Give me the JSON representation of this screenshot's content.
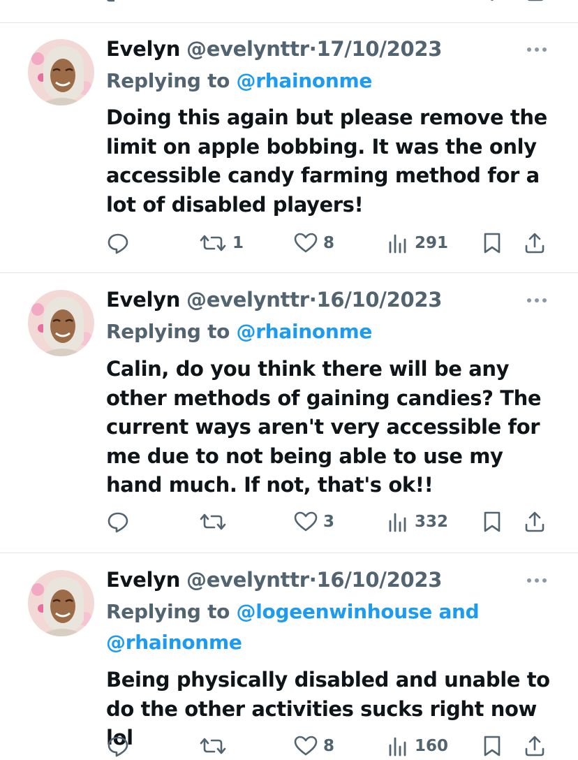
{
  "tweets": [
    {
      "name": "Evelyn",
      "handle": "@evelynttr",
      "separator": "·",
      "date": "17/10/2023",
      "replying_prefix": "Replying to",
      "replying_to": "@rhainonme",
      "replying_line2": "",
      "text": "Doing this again but please remove the limit on apple bobbing. It was the only accessible candy farming method for a lot of disabled players!",
      "retweets": "1",
      "likes": "8",
      "views": "291"
    },
    {
      "name": "Evelyn",
      "handle": "@evelynttr",
      "separator": "·",
      "date": "16/10/2023",
      "replying_prefix": "Replying to",
      "replying_to": "@rhainonme",
      "replying_line2": "",
      "text": "Calin, do you think there will be any other methods of gaining candies? The current ways aren't very accessible for me due to not being able to use my hand much. If not, that's ok!!",
      "retweets": "",
      "likes": "3",
      "views": "332"
    },
    {
      "name": "Evelyn",
      "handle": "@evelynttr",
      "separator": "·",
      "date": "16/10/2023",
      "replying_prefix": "Replying to",
      "replying_to": "@logeenwinhouse and",
      "replying_line2": "@rhainonme",
      "text": "Being physically disabled and unable to do the other activities sucks right now lol",
      "retweets": "",
      "likes": "8",
      "views": "160"
    }
  ],
  "icons": {
    "reply": "speech-bubble",
    "retweet": "retweet-arrows",
    "like": "heart-outline",
    "views": "bar-chart",
    "bookmark": "bookmark-outline",
    "share": "upload-arrow",
    "more": "three-dots"
  },
  "colors": {
    "text": "#0f1419",
    "secondary": "#536471",
    "link": "#1d9bf0",
    "divider": "#e1e6ea"
  }
}
